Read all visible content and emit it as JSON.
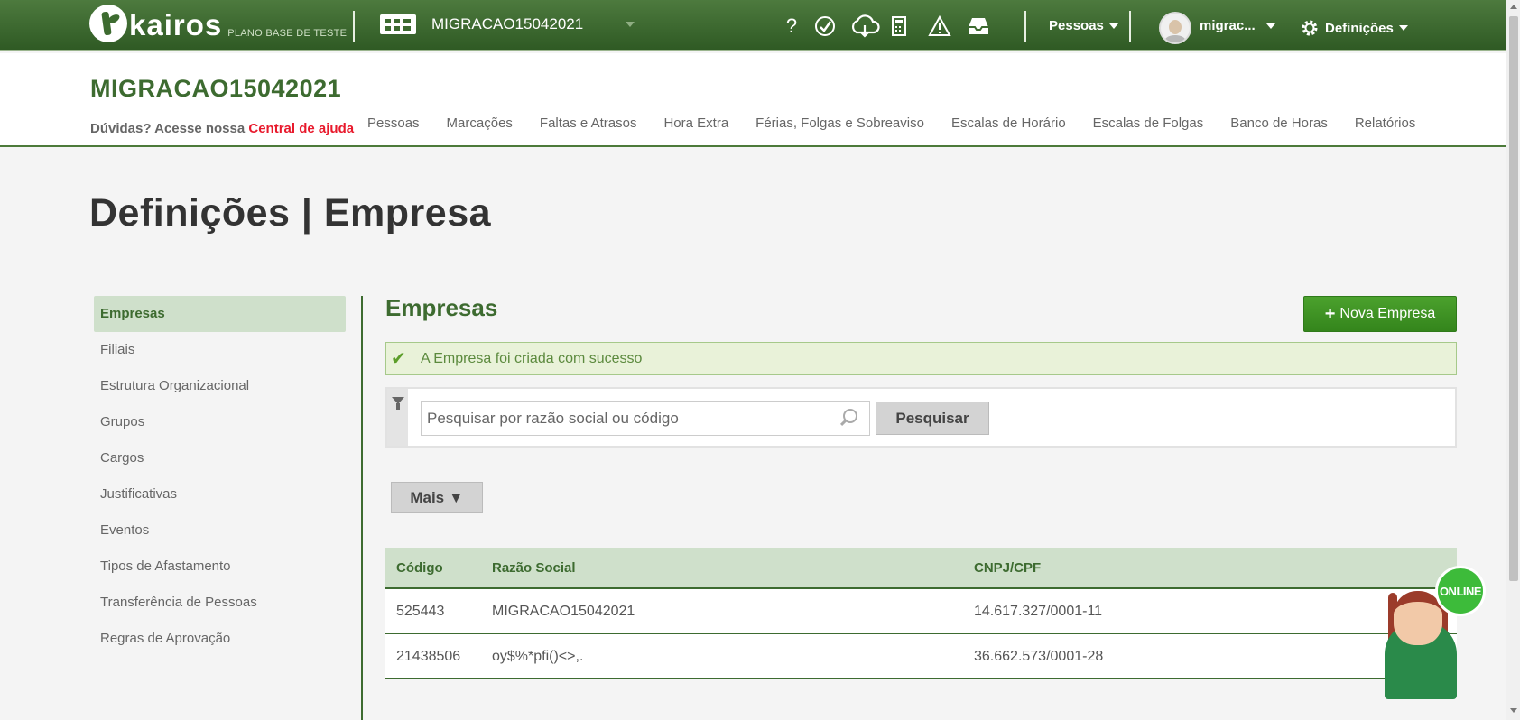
{
  "topbar": {
    "logo_text": "kairos",
    "logo_sub": "PLANO BASE DE TESTE",
    "company_name": "MIGRACAO15042021",
    "icons": [
      "help-icon",
      "clock-check-icon",
      "cloud-sync-icon",
      "calculator-icon",
      "warning-icon",
      "inbox-icon"
    ],
    "icon_glyphs": {
      "help": "?",
      "calculator": "▦",
      "warning": "⚠"
    },
    "people_menu": "Pessoas",
    "user_name": "migrac...",
    "settings_menu": "Definições"
  },
  "subheader": {
    "title": "MIGRACAO15042021",
    "help_text": "Dúvidas? Acesse nossa",
    "help_link": "Central de ajuda",
    "nav": [
      "Pessoas",
      "Marcações",
      "Faltas e Atrasos",
      "Hora Extra",
      "Férias, Folgas e Sobreaviso",
      "Escalas de Horário",
      "Escalas de Folgas",
      "Banco de Horas",
      "Relatórios"
    ]
  },
  "page_title": "Definições | Empresa",
  "sidebar": {
    "items": [
      "Empresas",
      "Filiais",
      "Estrutura Organizacional",
      "Grupos",
      "Cargos",
      "Justificativas",
      "Eventos",
      "Tipos de Afastamento",
      "Transferência de Pessoas",
      "Regras de Aprovação"
    ],
    "active": "Empresas"
  },
  "main": {
    "section_title": "Empresas",
    "new_button": "Nova Empresa",
    "alert": "A Empresa foi criada com sucesso",
    "search_placeholder": "Pesquisar por razão social ou código",
    "search_button": "Pesquisar",
    "more_button": "Mais ▼"
  },
  "table": {
    "headers": [
      "Código",
      "Razão Social",
      "CNPJ/CPF"
    ],
    "rows": [
      [
        "525443",
        "MIGRACAO15042021",
        "14.617.327/0001-11"
      ],
      [
        "21438506",
        "oy$%*pfi()<>,.",
        "36.662.573/0001-28"
      ]
    ]
  },
  "chat": {
    "badge": "ONLINE"
  },
  "colors": {
    "brand_green": "#3d6b30",
    "accent_green": "#3a8f22",
    "help_red": "#e8192c"
  }
}
